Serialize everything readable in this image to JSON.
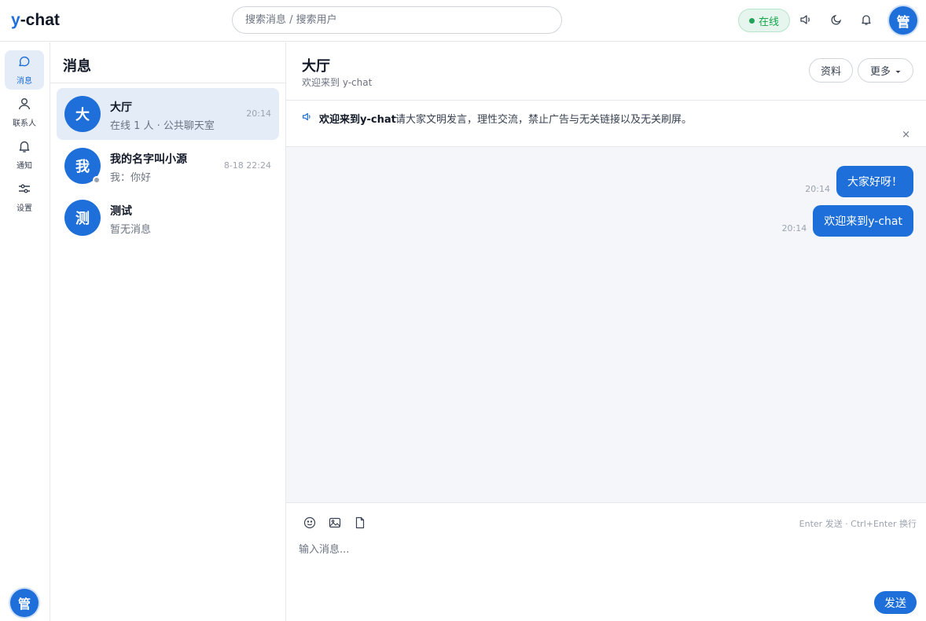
{
  "app": {
    "logo_prefix": "y",
    "logo_rest": "-chat"
  },
  "topbar": {
    "search_placeholder": "搜索消息 / 搜索用户",
    "status_label": "在线",
    "user_avatar": "管"
  },
  "rail": {
    "items": [
      {
        "label": "消息",
        "icon": "chat-bubble-icon",
        "active": true
      },
      {
        "label": "联系人",
        "icon": "person-icon"
      },
      {
        "label": "通知",
        "icon": "bell-icon"
      },
      {
        "label": "设置",
        "icon": "sliders-icon"
      }
    ],
    "user_avatar": "管"
  },
  "conversations": {
    "title": "消息",
    "items": [
      {
        "avatar": "大",
        "name": "大厅",
        "preview": "在线 1 人 · 公共聊天室",
        "time": "20:14",
        "active": true
      },
      {
        "avatar": "我",
        "name": "我的名字叫小源",
        "preview": "我：你好",
        "time": "8-18 22:24",
        "presence": "offline"
      },
      {
        "avatar": "测",
        "name": "测试",
        "preview": "暂无消息",
        "time": ""
      }
    ]
  },
  "chat": {
    "title": "大厅",
    "subtitle": "欢迎来到 y-chat",
    "profile_button": "资料",
    "more_button": "更多",
    "notice": {
      "title": "欢迎来到y-chat",
      "text": "请大家文明发言，理性交流，禁止广告与无关链接以及无关刷屏。",
      "close": "×"
    },
    "messages": [
      {
        "time": "20:14",
        "text": "大家好呀！",
        "outgoing": true
      },
      {
        "time": "20:14",
        "text": "欢迎来到y-chat",
        "outgoing": true
      }
    ],
    "composer": {
      "placeholder": "输入消息...",
      "hint": "Enter 发送 · Ctrl+Enter 换行",
      "send_label": "发送"
    }
  },
  "colors": {
    "accent": "#1e6fd9",
    "online_green": "#22a35a",
    "active_bg": "#e4ecf8",
    "chat_bg": "#f4f6fa"
  }
}
